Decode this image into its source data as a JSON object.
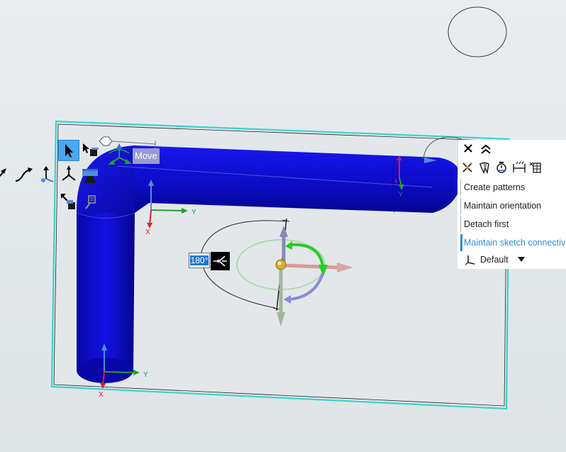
{
  "viewport": {
    "move_label": "Move",
    "angle_value": "180°",
    "triad_axes": {
      "x": "X",
      "y": "Y"
    }
  },
  "options_panel": {
    "items": [
      {
        "label": "Create patterns",
        "selected": false
      },
      {
        "label": "Maintain orientation",
        "selected": false
      },
      {
        "label": "Detach first",
        "selected": false
      },
      {
        "label": "Maintain sketch connectivity",
        "selected": true
      }
    ],
    "default_dropdown": {
      "label": "Default"
    }
  },
  "icons": {
    "toolbar": [
      "select-arrow-icon",
      "select-body-icon",
      "move-path-icon",
      "curve-path-icon",
      "anchor-icon",
      "triad-icon",
      "ruler-block-icon",
      "move-copy-icon",
      "pin-icon"
    ],
    "panel": [
      "close-icon",
      "collapse-icon",
      "compass-icon",
      "tooth-icon",
      "timer-icon",
      "dimension-icon",
      "table-icon",
      "axis-icon",
      "dropdown-arrow-icon"
    ]
  },
  "colors": {
    "body_blue": "#0a0ad0",
    "sketch_plane": "#3fd6cf",
    "axis_x": "#e0202a",
    "axis_y": "#1ea12c",
    "axis_z": "#3a6fd8",
    "highlight": "#2a8ee0"
  }
}
